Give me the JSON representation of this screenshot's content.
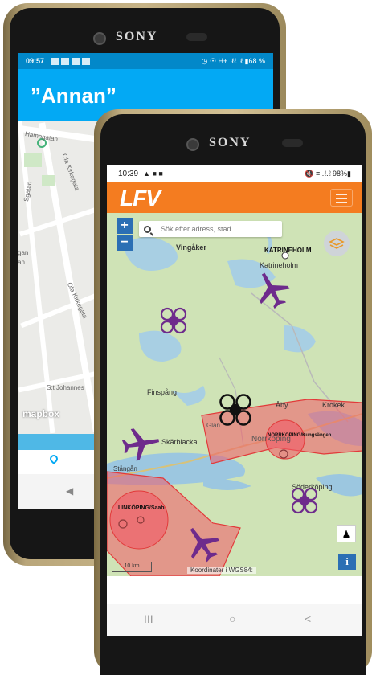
{
  "back_phone": {
    "brand": "SONY",
    "status": {
      "time": "09:57",
      "right": "◷ ☉ H+ .ℓℓ .ℓ ▮68 %"
    },
    "title": "”Annan”",
    "map_labels": {
      "street1": "Hamngatan",
      "street2": "Ola Kirkegata",
      "street3": "Ola Kirkegata",
      "street4": "S:t Johannes",
      "street5": "Sgatan",
      "left1": "ren",
      "left2": "gan",
      "left3": "an"
    },
    "attribution": "mapbox",
    "nav_back": "◀"
  },
  "front_phone": {
    "brand": "SONY",
    "status": {
      "time": "10:39",
      "right": "🔇 ≡ .ℓ.ℓ 98%▮"
    },
    "logo": "LFV",
    "search": {
      "placeholder": "Sök efter adress, stad..."
    },
    "zoom_in": "+",
    "zoom_out": "−",
    "places": {
      "vingaker": "Vingåker",
      "katrineholm_upper": "KATRINEHOLM",
      "katrineholm": "Katrineholm",
      "finspang": "Finspång",
      "aby": "Åby",
      "krokek": "Krokek",
      "glan": "Glan",
      "skarblacka": "Skärblacka",
      "norrkoping": "Norrköping",
      "norrkoping_airport": "NORRKÖPING/Kungsängen",
      "stangan": "Stångån",
      "linkoping": "LINKÖPING/Saab",
      "soderkoping": "Söderköping"
    },
    "scale": "10 km",
    "coords": "Koordinater i WGS84:",
    "info": "i",
    "nav": {
      "recent": "III",
      "home": "○",
      "back": "<"
    },
    "colors": {
      "appbar": "#f47c20",
      "zone_fill": "#f25a66",
      "zone_stroke": "#e23a3a",
      "aircraft": "#6e2b8c",
      "drone": "#6e2b8c"
    }
  }
}
